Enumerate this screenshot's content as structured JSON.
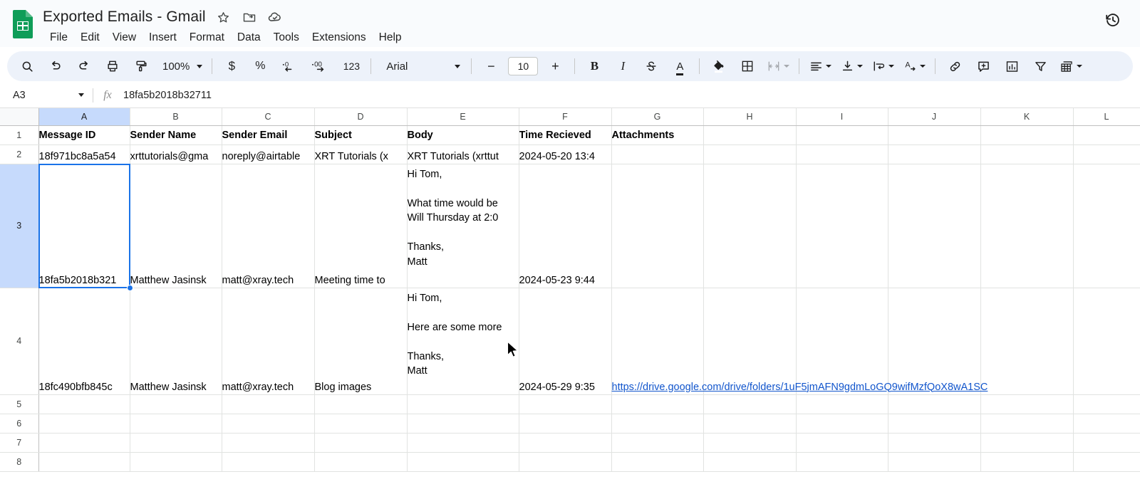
{
  "app": {
    "doc_title": "Exported Emails - Gmail",
    "logo_name": "google-sheets-logo"
  },
  "title_icons": [
    {
      "name": "star-icon",
      "glyph": "☆"
    },
    {
      "name": "move-to-folder-icon",
      "glyph": "folder"
    },
    {
      "name": "cloud-saved-icon",
      "glyph": "cloud"
    }
  ],
  "menu": {
    "items": [
      {
        "label": "File",
        "name": "menu-file"
      },
      {
        "label": "Edit",
        "name": "menu-edit"
      },
      {
        "label": "View",
        "name": "menu-view"
      },
      {
        "label": "Insert",
        "name": "menu-insert"
      },
      {
        "label": "Format",
        "name": "menu-format"
      },
      {
        "label": "Data",
        "name": "menu-data"
      },
      {
        "label": "Tools",
        "name": "menu-tools"
      },
      {
        "label": "Extensions",
        "name": "menu-extensions"
      },
      {
        "label": "Help",
        "name": "menu-help"
      }
    ]
  },
  "top_right": {
    "history_icon": "version-history-icon"
  },
  "toolbar": {
    "zoom_level": "100%",
    "font_family": "Arial",
    "font_size": "10",
    "number_123": "123",
    "percent_symbol": "%",
    "currency_symbol": "$",
    "decrease_decimal": ".0",
    "increase_decimal": ".00",
    "bold": "B",
    "italic": "I",
    "strikethrough": "S",
    "text_color": "A",
    "minus": "−",
    "plus": "+"
  },
  "formula_bar": {
    "name_box_value": "A3",
    "fx_label": "fx",
    "formula_value": "18fa5b2018b32711"
  },
  "grid": {
    "column_letters": [
      "A",
      "B",
      "C",
      "D",
      "E",
      "F",
      "G",
      "H",
      "I",
      "J",
      "K",
      "L"
    ],
    "selected_column": "A",
    "selected_row": 3,
    "row_numbers": [
      "1",
      "2",
      "3",
      "4",
      "5",
      "6",
      "7",
      "8"
    ],
    "headers": {
      "A": "Message ID",
      "B": "Sender Name",
      "C": "Sender Email",
      "D": "Subject",
      "E": "Body",
      "F": "Time Recieved",
      "G": "Attachments"
    },
    "row2": {
      "message_id": "18f971bc8a5a54",
      "sender_name": "xrttutorials@gma",
      "sender_email": "noreply@airtable",
      "subject": "XRT Tutorials (x",
      "body": "XRT Tutorials (xrttut",
      "time_recieved": "2024-05-20 13:4",
      "attachments": ""
    },
    "row3": {
      "message_id": "18fa5b2018b321",
      "sender_name": "Matthew Jasinsk",
      "sender_email": "matt@xray.tech",
      "subject": "Meeting time to ",
      "body": "Hi Tom,\n\nWhat time would be\nWill Thursday at 2:0\n\nThanks,\nMatt",
      "time_recieved": "2024-05-23 9:44",
      "attachments": ""
    },
    "row4": {
      "message_id": "18fc490bfb845c",
      "sender_name": "Matthew Jasinsk",
      "sender_email": "matt@xray.tech",
      "subject": "Blog images",
      "body": "Hi Tom,\n\nHere are some more\n\nThanks,\nMatt",
      "time_recieved": "2024-05-29 9:35",
      "attachments": "https://drive.google.com/drive/folders/1uF5jmAFN9gdmLoGQ9wifMzfQoX8wA1SC"
    }
  },
  "colors": {
    "accent_blue": "#1a73e8",
    "selection_header": "#c6dafc",
    "toolbar_bg": "#edf2fa",
    "topbar_bg": "#f9fbfd",
    "link_blue": "#1155cc",
    "sheets_green": "#0f9d58"
  }
}
